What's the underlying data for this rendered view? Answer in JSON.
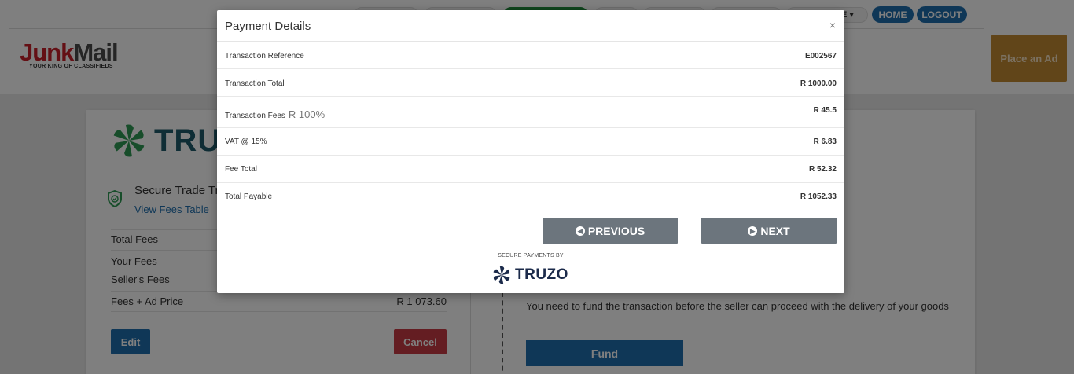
{
  "header": {
    "nav_dropdown_label": "E ▾",
    "home_label": "HOME",
    "logout_label": "LOGOUT",
    "logo_primary_red": "Junk",
    "logo_primary_gray": "Mail",
    "logo_tagline": "YOUR KING OF CLASSIFIEDS",
    "place_ad_label": "Place an Ad"
  },
  "page": {
    "truzo_logo_partial": "TRUZ",
    "secure_trade_title": "Secure Trade Tr",
    "view_fees_link": "View Fees Table",
    "fees": [
      {
        "label": "Total Fees",
        "value": ""
      },
      {
        "label": "Your Fees",
        "value": ""
      },
      {
        "label": "Seller's Fees",
        "value": ""
      },
      {
        "label": "Fees + Ad Price",
        "value": "R 1 073.60"
      }
    ],
    "edit_label": "Edit",
    "cancel_label": "Cancel",
    "fund_message": "You need to fund the transaction before the seller can proceed with the delivery of your goods",
    "fund_label": "Fund"
  },
  "modal": {
    "title": "Payment Details",
    "close_glyph": "×",
    "rows": [
      {
        "label": "Transaction Reference",
        "sub": "",
        "value": "E002567"
      },
      {
        "label": "Transaction Total",
        "sub": "",
        "value": "R 1000.00"
      },
      {
        "label": "Transaction Fees",
        "sub": "R 100%",
        "value": "R 45.5"
      },
      {
        "label": "VAT @ 15%",
        "sub": "",
        "value": "R 6.83"
      },
      {
        "label": "Fee Total",
        "sub": "",
        "value": "R 52.32"
      },
      {
        "label": "Total Payable",
        "sub": "",
        "value": "R 1052.33"
      }
    ],
    "previous_label": "PREVIOUS",
    "next_label": "NEXT",
    "secure_by": "SECURE PAYMENTS BY",
    "truzo_label": "TRUZO"
  },
  "icons": {
    "previous": "chevron-left-circle-icon",
    "next": "chevron-right-circle-icon",
    "close": "close-icon",
    "shield": "shield-check-icon",
    "truzo_mark": "truzo-pinwheel-icon"
  },
  "colors": {
    "primary": "#1f6fae",
    "danger": "#c83b44",
    "secondary": "#6c757d",
    "place_ad": "#c38a33",
    "truzo_green": "#2f9a55",
    "truzo_navy": "#1b2a4a"
  }
}
